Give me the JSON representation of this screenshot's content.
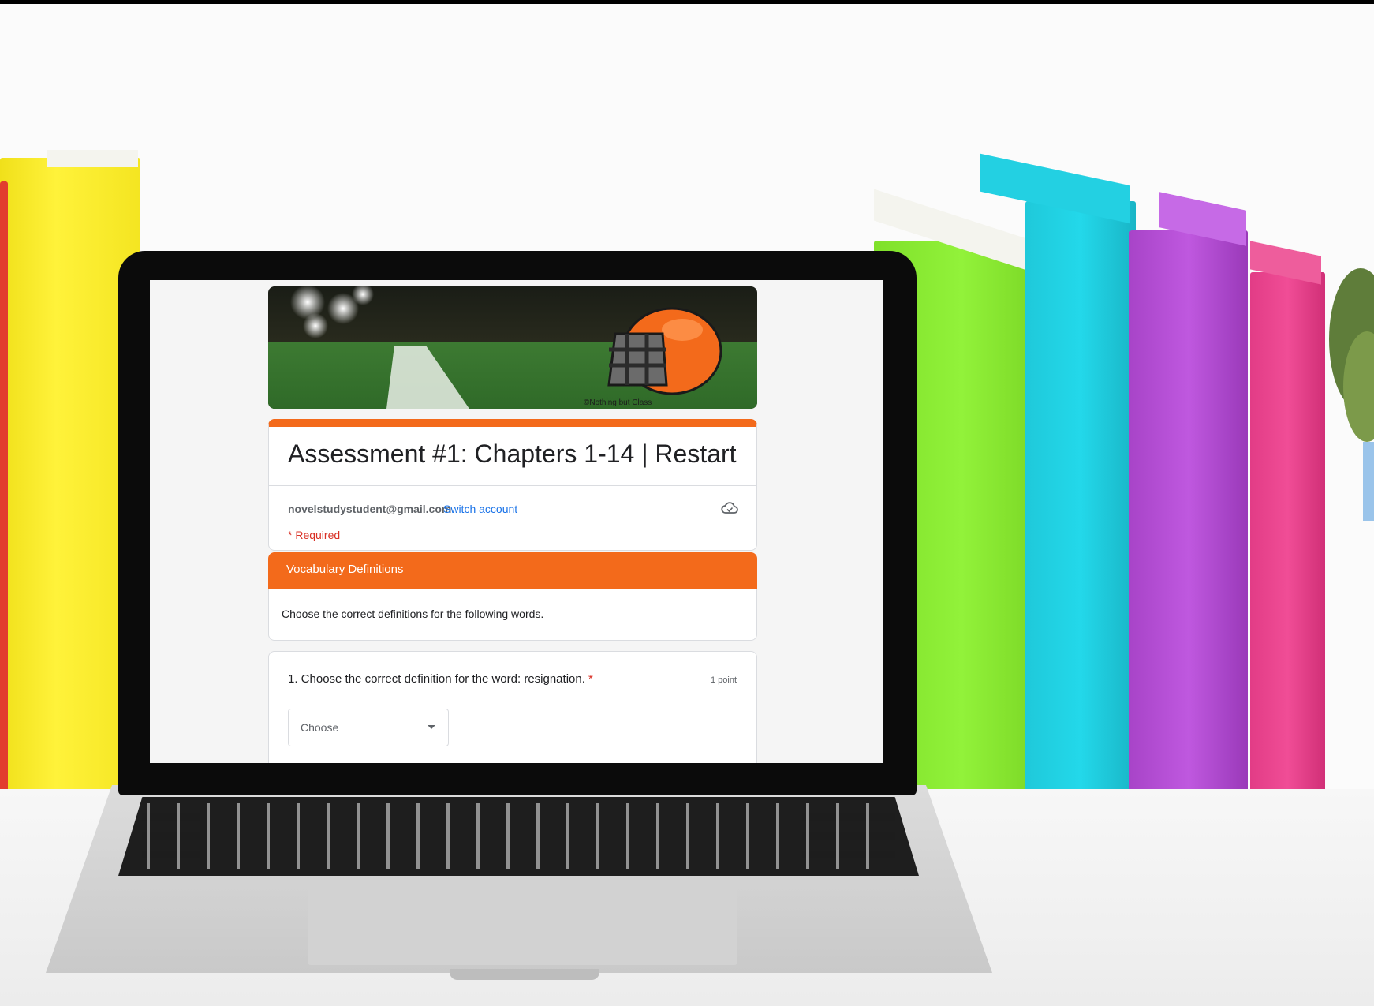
{
  "form": {
    "title": "Assessment #1: Chapters 1-14 | Restart",
    "email": "novelstudystudent@gmail.com",
    "switch_account": "Switch account",
    "required_note": "* Required",
    "banner_credit": "©Nothing but Class"
  },
  "section": {
    "title": "Vocabulary Definitions",
    "description": "Choose the correct definitions for the following words."
  },
  "question": {
    "number_text": "1. Choose the correct definition for the word: resignation.",
    "required_star": "*",
    "points": "1 point",
    "dropdown_placeholder": "Choose"
  },
  "colors": {
    "accent": "#f36a1b",
    "link": "#1a73e8",
    "required": "#d93025"
  }
}
